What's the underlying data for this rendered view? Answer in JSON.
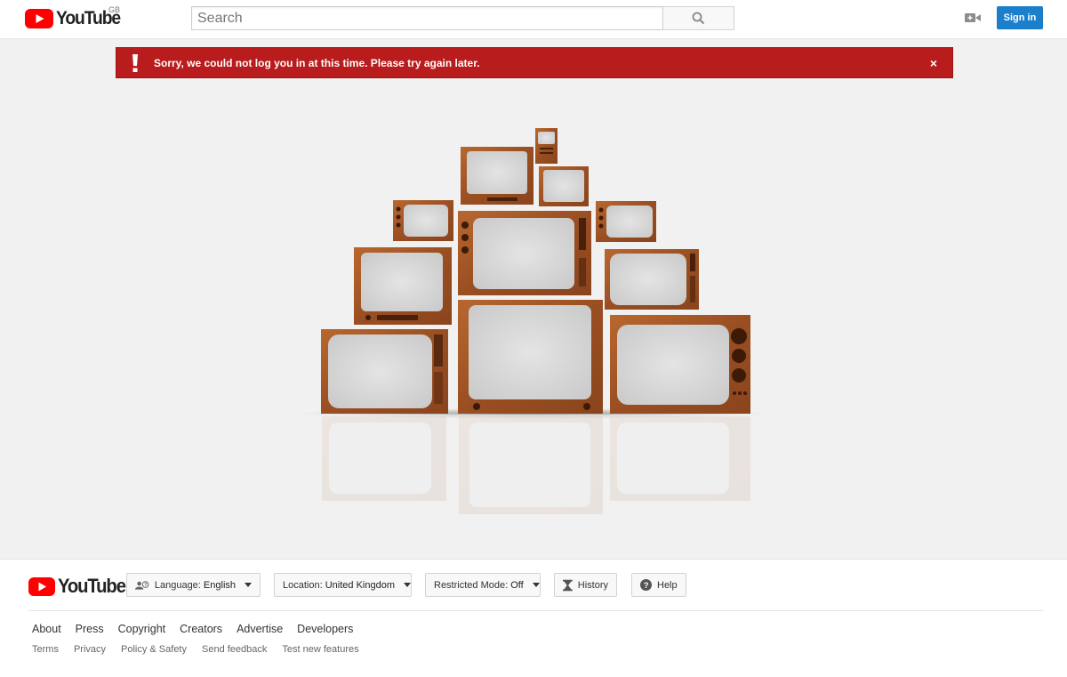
{
  "masthead": {
    "logo_text": "YouTube",
    "region": "GB",
    "search_placeholder": "Search",
    "search_icon": "search-icon",
    "upload_icon": "video-camera-icon",
    "signin_label": "Sign in"
  },
  "alert": {
    "icon": "exclamation-icon",
    "message": "Sorry, we could not log you in at this time. Please try again later.",
    "close_label": "×",
    "color": "#b91c1c"
  },
  "illustration": {
    "name": "stacked-retro-tvs"
  },
  "footer": {
    "logo_text": "YouTube",
    "language": {
      "prefix": "Language:",
      "value": "English",
      "icon": "language-icon"
    },
    "location": {
      "prefix": "Location:",
      "value": "United Kingdom"
    },
    "restricted": {
      "prefix": "Restricted Mode:",
      "value": "Off"
    },
    "history_label": "History",
    "history_icon": "hourglass-icon",
    "help_label": "Help",
    "help_icon": "help-circle-icon",
    "primary_links": [
      "About",
      "Press",
      "Copyright",
      "Creators",
      "Advertise",
      "Developers"
    ],
    "secondary_links": [
      "Terms",
      "Privacy",
      "Policy & Safety",
      "Send feedback",
      "Test new features"
    ]
  },
  "colors": {
    "brand_red": "#ff0000",
    "signin_blue": "#1b7fcc",
    "tv_wood": "#a0552a"
  }
}
